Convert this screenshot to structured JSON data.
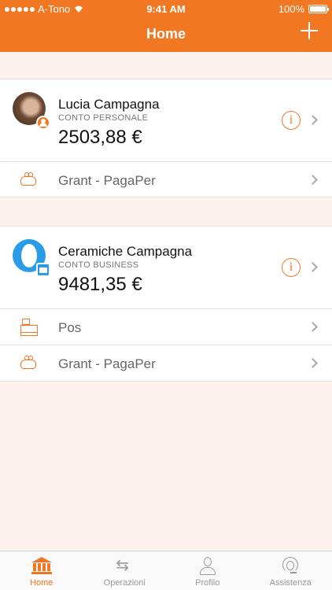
{
  "status_bar": {
    "carrier": "A-Tono",
    "time": "9:41 AM",
    "battery": "100%"
  },
  "header": {
    "title": "Home"
  },
  "accounts": [
    {
      "name": "Lucia Campagna",
      "type": "CONTO PERSONALE",
      "balance": "2503,88 €",
      "rows": [
        {
          "label": "Grant - PagaPer",
          "icon": "purse-icon"
        }
      ]
    },
    {
      "name": "Ceramiche Campagna",
      "type": "CONTO BUSINESS",
      "balance": "9481,35 €",
      "rows": [
        {
          "label": "Pos",
          "icon": "cash-register-icon"
        },
        {
          "label": "Grant - PagaPer",
          "icon": "purse-icon"
        }
      ]
    }
  ],
  "tabs": [
    {
      "label": "Home",
      "icon": "bank-icon",
      "active": true
    },
    {
      "label": "Operazioni",
      "icon": "transfer-arrows-icon",
      "active": false
    },
    {
      "label": "Profilo",
      "icon": "person-icon",
      "active": false
    },
    {
      "label": "Assistenza",
      "icon": "headset-icon",
      "active": false
    }
  ],
  "colors": {
    "accent": "#f27722",
    "background": "#fdf1ec",
    "business": "#2a9be6"
  }
}
